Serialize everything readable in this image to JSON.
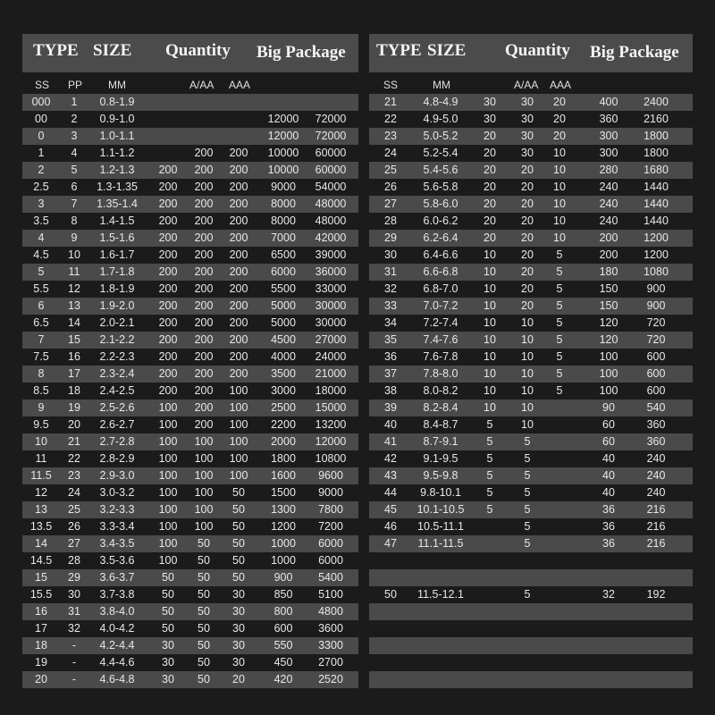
{
  "left": {
    "header": {
      "type": "TYPE",
      "size": "SIZE",
      "quantity": "Quantity",
      "big_package": "Big Package"
    },
    "subheader": {
      "ss": "SS",
      "pp": "PP",
      "mm": "MM",
      "a_aa": "A/AA",
      "aaa": "AAA"
    },
    "rows": [
      [
        "000",
        "1",
        "0.8-1.9",
        "",
        "",
        "",
        "",
        ""
      ],
      [
        "00",
        "2",
        "0.9-1.0",
        "",
        "",
        "",
        "12000",
        "72000"
      ],
      [
        "0",
        "3",
        "1.0-1.1",
        "",
        "",
        "",
        "12000",
        "72000"
      ],
      [
        "1",
        "4",
        "1.1-1.2",
        "",
        "200",
        "200",
        "10000",
        "60000"
      ],
      [
        "2",
        "5",
        "1.2-1.3",
        "200",
        "200",
        "200",
        "10000",
        "60000"
      ],
      [
        "2.5",
        "6",
        "1.3-1.35",
        "200",
        "200",
        "200",
        "9000",
        "54000"
      ],
      [
        "3",
        "7",
        "1.35-1.4",
        "200",
        "200",
        "200",
        "8000",
        "48000"
      ],
      [
        "3.5",
        "8",
        "1.4-1.5",
        "200",
        "200",
        "200",
        "8000",
        "48000"
      ],
      [
        "4",
        "9",
        "1.5-1.6",
        "200",
        "200",
        "200",
        "7000",
        "42000"
      ],
      [
        "4.5",
        "10",
        "1.6-1.7",
        "200",
        "200",
        "200",
        "6500",
        "39000"
      ],
      [
        "5",
        "11",
        "1.7-1.8",
        "200",
        "200",
        "200",
        "6000",
        "36000"
      ],
      [
        "5.5",
        "12",
        "1.8-1.9",
        "200",
        "200",
        "200",
        "5500",
        "33000"
      ],
      [
        "6",
        "13",
        "1.9-2.0",
        "200",
        "200",
        "200",
        "5000",
        "30000"
      ],
      [
        "6.5",
        "14",
        "2.0-2.1",
        "200",
        "200",
        "200",
        "5000",
        "30000"
      ],
      [
        "7",
        "15",
        "2.1-2.2",
        "200",
        "200",
        "200",
        "4500",
        "27000"
      ],
      [
        "7.5",
        "16",
        "2.2-2.3",
        "200",
        "200",
        "200",
        "4000",
        "24000"
      ],
      [
        "8",
        "17",
        "2.3-2.4",
        "200",
        "200",
        "200",
        "3500",
        "21000"
      ],
      [
        "8.5",
        "18",
        "2.4-2.5",
        "200",
        "200",
        "100",
        "3000",
        "18000"
      ],
      [
        "9",
        "19",
        "2.5-2.6",
        "100",
        "200",
        "100",
        "2500",
        "15000"
      ],
      [
        "9.5",
        "20",
        "2.6-2.7",
        "100",
        "200",
        "100",
        "2200",
        "13200"
      ],
      [
        "10",
        "21",
        "2.7-2.8",
        "100",
        "100",
        "100",
        "2000",
        "12000"
      ],
      [
        "11",
        "22",
        "2.8-2.9",
        "100",
        "100",
        "100",
        "1800",
        "10800"
      ],
      [
        "11.5",
        "23",
        "2.9-3.0",
        "100",
        "100",
        "100",
        "1600",
        "9600"
      ],
      [
        "12",
        "24",
        "3.0-3.2",
        "100",
        "100",
        "50",
        "1500",
        "9000"
      ],
      [
        "13",
        "25",
        "3.2-3.3",
        "100",
        "100",
        "50",
        "1300",
        "7800"
      ],
      [
        "13.5",
        "26",
        "3.3-3.4",
        "100",
        "100",
        "50",
        "1200",
        "7200"
      ],
      [
        "14",
        "27",
        "3.4-3.5",
        "100",
        "50",
        "50",
        "1000",
        "6000"
      ],
      [
        "14.5",
        "28",
        "3.5-3.6",
        "100",
        "50",
        "50",
        "1000",
        "6000"
      ],
      [
        "15",
        "29",
        "3.6-3.7",
        "50",
        "50",
        "50",
        "900",
        "5400"
      ],
      [
        "15.5",
        "30",
        "3.7-3.8",
        "50",
        "50",
        "30",
        "850",
        "5100"
      ],
      [
        "16",
        "31",
        "3.8-4.0",
        "50",
        "50",
        "30",
        "800",
        "4800"
      ],
      [
        "17",
        "32",
        "4.0-4.2",
        "50",
        "50",
        "30",
        "600",
        "3600"
      ],
      [
        "18",
        "-",
        "4.2-4.4",
        "30",
        "50",
        "30",
        "550",
        "3300"
      ],
      [
        "19",
        "-",
        "4.4-4.6",
        "30",
        "50",
        "30",
        "450",
        "2700"
      ],
      [
        "20",
        "-",
        "4.6-4.8",
        "30",
        "50",
        "20",
        "420",
        "2520"
      ]
    ]
  },
  "right": {
    "header": {
      "type": "TYPE",
      "size": "SIZE",
      "quantity": "Quantity",
      "big_package": "Big Package"
    },
    "subheader": {
      "ss": "SS",
      "mm": "MM",
      "a_aa": "A/AA",
      "aaa": "AAA"
    },
    "rows": [
      [
        "21",
        "4.8-4.9",
        "30",
        "30",
        "20",
        "400",
        "2400"
      ],
      [
        "22",
        "4.9-5.0",
        "30",
        "30",
        "20",
        "360",
        "2160"
      ],
      [
        "23",
        "5.0-5.2",
        "20",
        "30",
        "20",
        "300",
        "1800"
      ],
      [
        "24",
        "5.2-5.4",
        "20",
        "30",
        "10",
        "300",
        "1800"
      ],
      [
        "25",
        "5.4-5.6",
        "20",
        "20",
        "10",
        "280",
        "1680"
      ],
      [
        "26",
        "5.6-5.8",
        "20",
        "20",
        "10",
        "240",
        "1440"
      ],
      [
        "27",
        "5.8-6.0",
        "20",
        "20",
        "10",
        "240",
        "1440"
      ],
      [
        "28",
        "6.0-6.2",
        "20",
        "20",
        "10",
        "240",
        "1440"
      ],
      [
        "29",
        "6.2-6.4",
        "20",
        "20",
        "10",
        "200",
        "1200"
      ],
      [
        "30",
        "6.4-6.6",
        "10",
        "20",
        "5",
        "200",
        "1200"
      ],
      [
        "31",
        "6.6-6.8",
        "10",
        "20",
        "5",
        "180",
        "1080"
      ],
      [
        "32",
        "6.8-7.0",
        "10",
        "20",
        "5",
        "150",
        "900"
      ],
      [
        "33",
        "7.0-7.2",
        "10",
        "20",
        "5",
        "150",
        "900"
      ],
      [
        "34",
        "7.2-7.4",
        "10",
        "10",
        "5",
        "120",
        "720"
      ],
      [
        "35",
        "7.4-7.6",
        "10",
        "10",
        "5",
        "120",
        "720"
      ],
      [
        "36",
        "7.6-7.8",
        "10",
        "10",
        "5",
        "100",
        "600"
      ],
      [
        "37",
        "7.8-8.0",
        "10",
        "10",
        "5",
        "100",
        "600"
      ],
      [
        "38",
        "8.0-8.2",
        "10",
        "10",
        "5",
        "100",
        "600"
      ],
      [
        "39",
        "8.2-8.4",
        "10",
        "10",
        "",
        "90",
        "540"
      ],
      [
        "40",
        "8.4-8.7",
        "5",
        "10",
        "",
        "60",
        "360"
      ],
      [
        "41",
        "8.7-9.1",
        "5",
        "5",
        "",
        "60",
        "360"
      ],
      [
        "42",
        "9.1-9.5",
        "5",
        "5",
        "",
        "40",
        "240"
      ],
      [
        "43",
        "9.5-9.8",
        "5",
        "5",
        "",
        "40",
        "240"
      ],
      [
        "44",
        "9.8-10.1",
        "5",
        "5",
        "",
        "40",
        "240"
      ],
      [
        "45",
        "10.1-10.5",
        "5",
        "5",
        "",
        "36",
        "216"
      ],
      [
        "46",
        "10.5-11.1",
        "",
        "5",
        "",
        "36",
        "216"
      ],
      [
        "47",
        "11.1-11.5",
        "",
        "5",
        "",
        "36",
        "216"
      ],
      [
        "",
        "",
        "",
        "",
        "",
        "",
        ""
      ],
      [
        "",
        "",
        "",
        "",
        "",
        "",
        ""
      ],
      [
        "50",
        "11.5-12.1",
        "",
        "5",
        "",
        "32",
        "192"
      ],
      [
        "",
        "",
        "",
        "",
        "",
        "",
        ""
      ],
      [
        "",
        "",
        "",
        "",
        "",
        "",
        ""
      ],
      [
        "",
        "",
        "",
        "",
        "",
        "",
        ""
      ],
      [
        "",
        "",
        "",
        "",
        "",
        "",
        ""
      ],
      [
        "",
        "",
        "",
        "",
        "",
        "",
        ""
      ]
    ]
  }
}
